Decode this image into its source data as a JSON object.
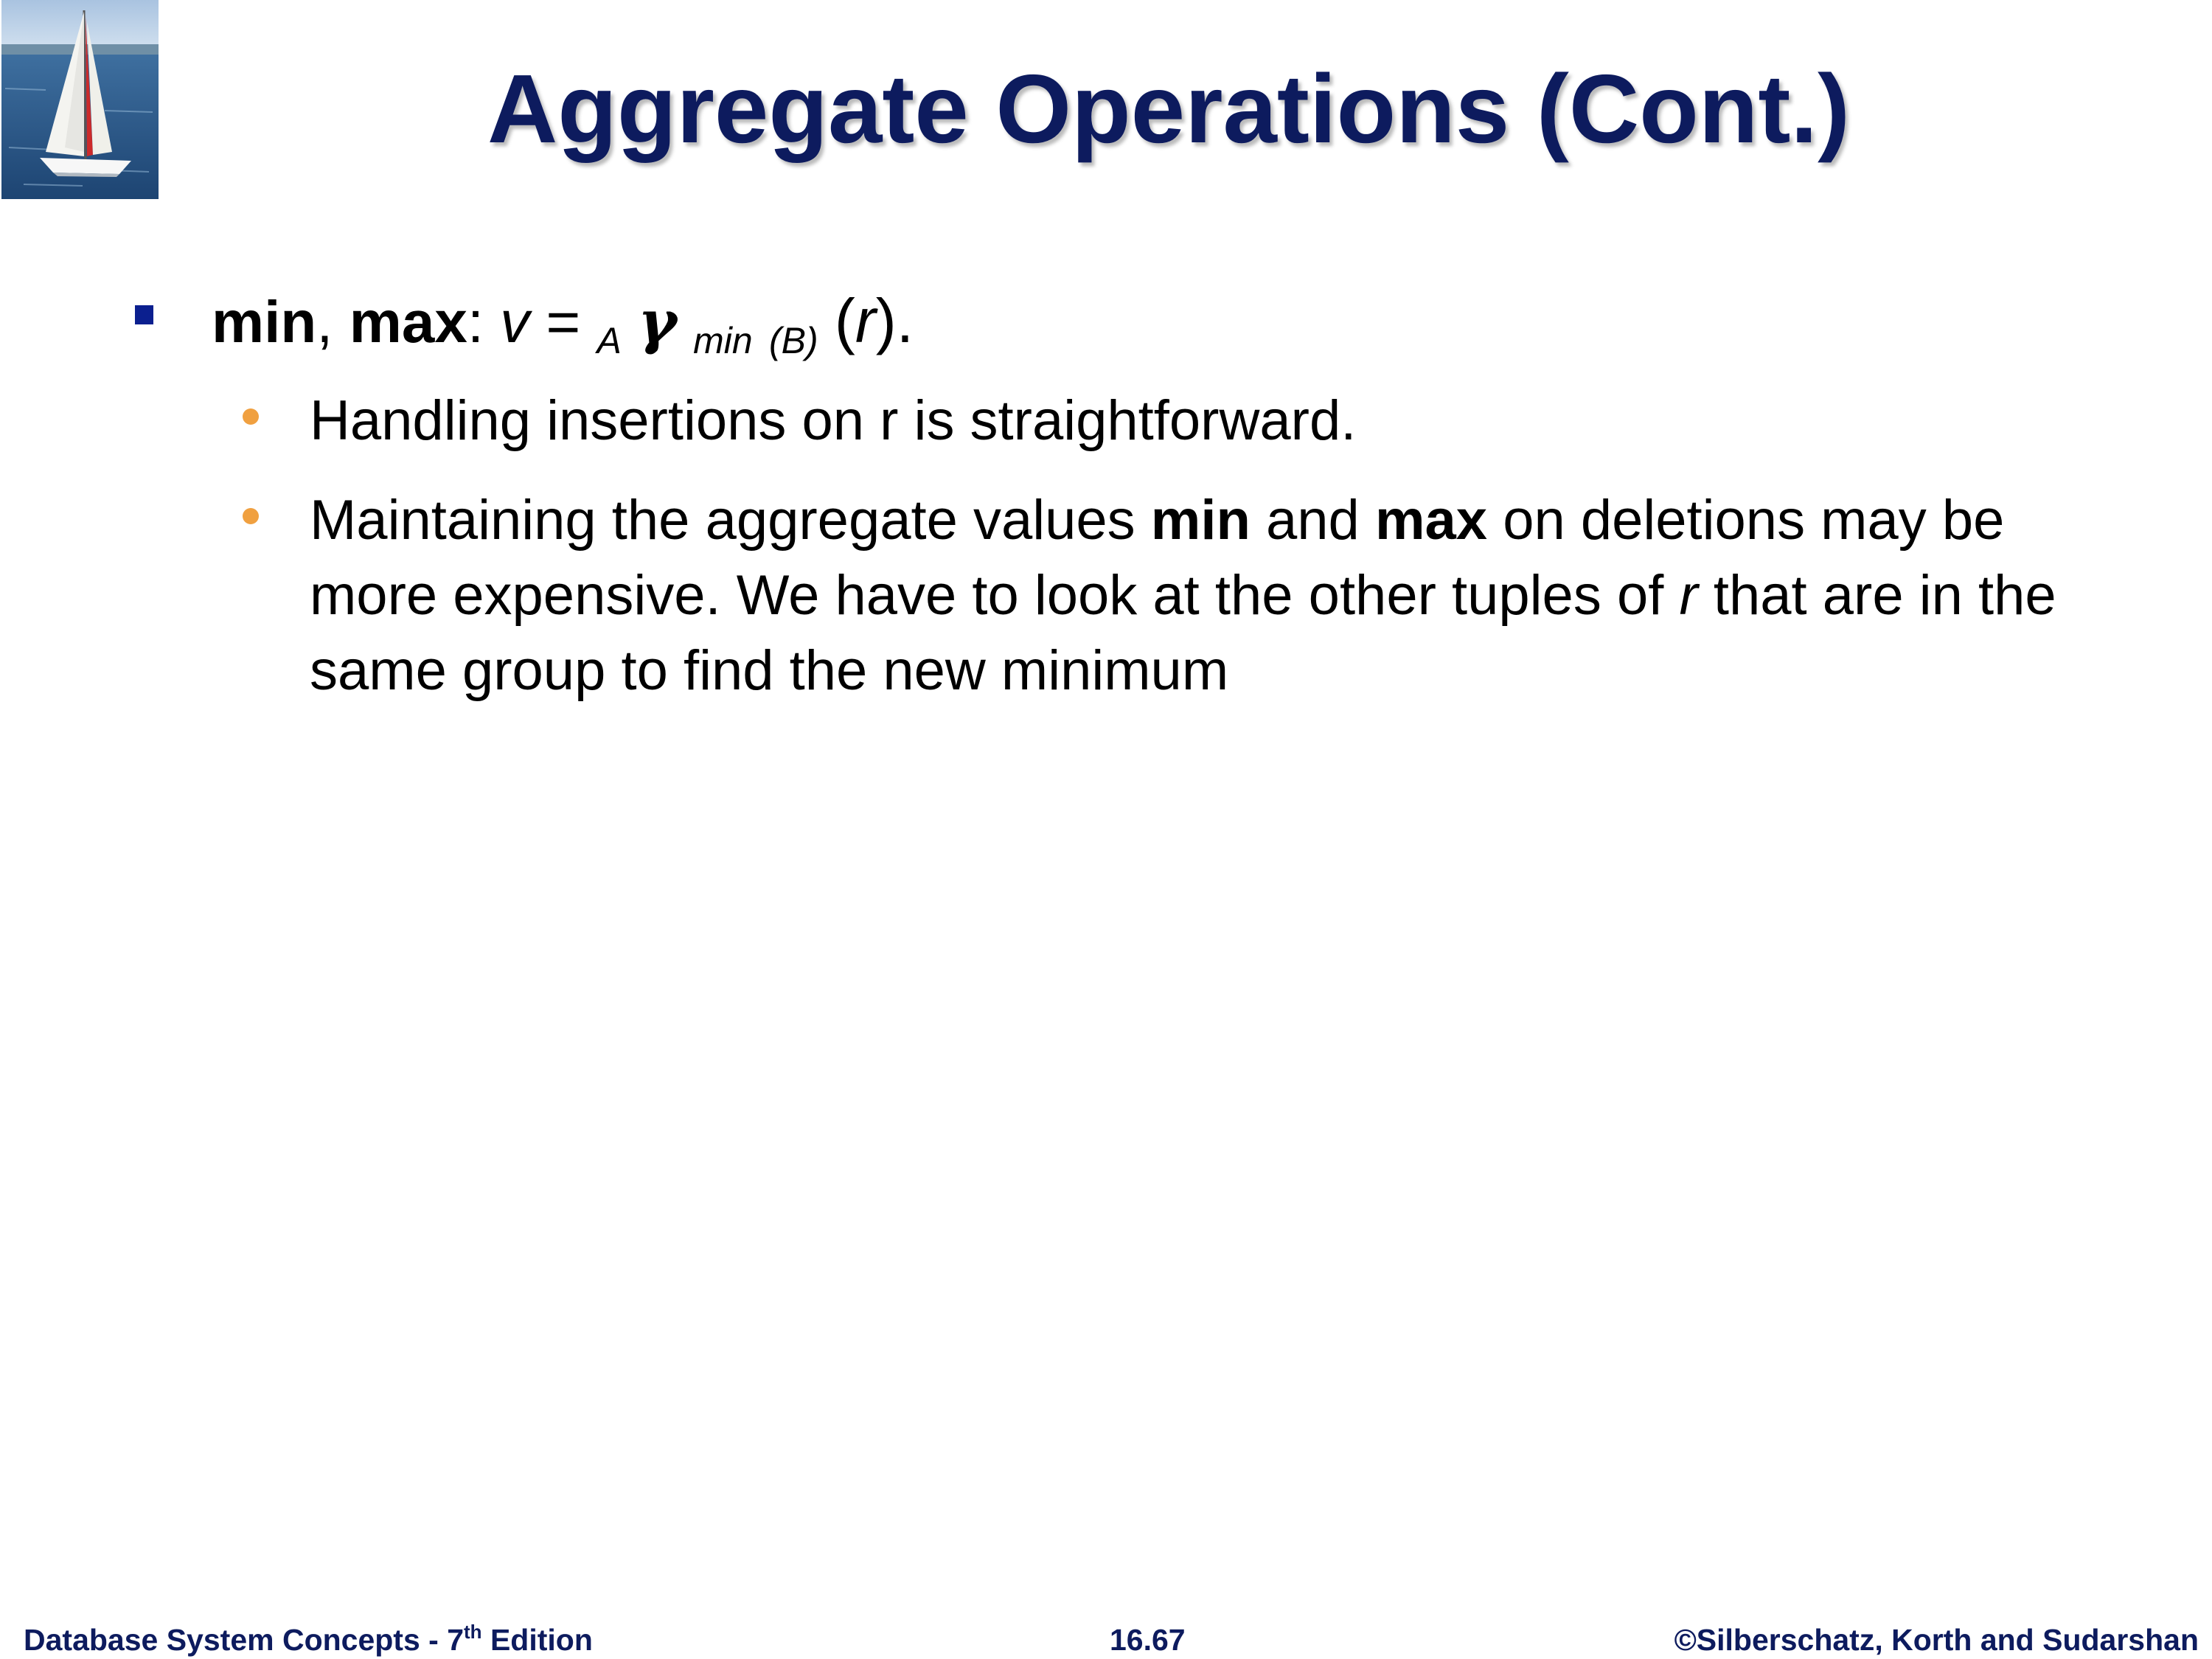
{
  "title": "Aggregate Operations (Cont.)",
  "bullet1": {
    "term_min": "min",
    "comma": ",",
    "term_max": "max",
    "colon": ":",
    "var_v": "v",
    "equals": "=",
    "sub_A": "A",
    "gamma": "γ",
    "sub_min": "min",
    "sub_B": "(B)",
    "paren_open": "(",
    "var_r": "r",
    "paren_close": ").",
    "sub_items": [
      {
        "text": "Handling insertions on r is straightforward."
      },
      {
        "part1": "Maintaining the aggregate values ",
        "bold1": "min",
        "part2": " and ",
        "bold2": "max",
        "part3": " on deletions may be more expensive. We have to look at the other tuples of ",
        "italic_r": "r",
        "part4": " that are in the same group to find the new minimum"
      }
    ]
  },
  "footer": {
    "left_prefix": "Database System Concepts - 7",
    "left_sup": "th",
    "left_suffix": " Edition",
    "center": "16.67",
    "right": "©Silberschatz, Korth and Sudarshan"
  },
  "colors": {
    "title": "#0d1b5e",
    "square_bullet": "#0b1f8f",
    "round_bullet": "#f0a040"
  },
  "logo": {
    "icon": "sailboat-logo-icon"
  }
}
